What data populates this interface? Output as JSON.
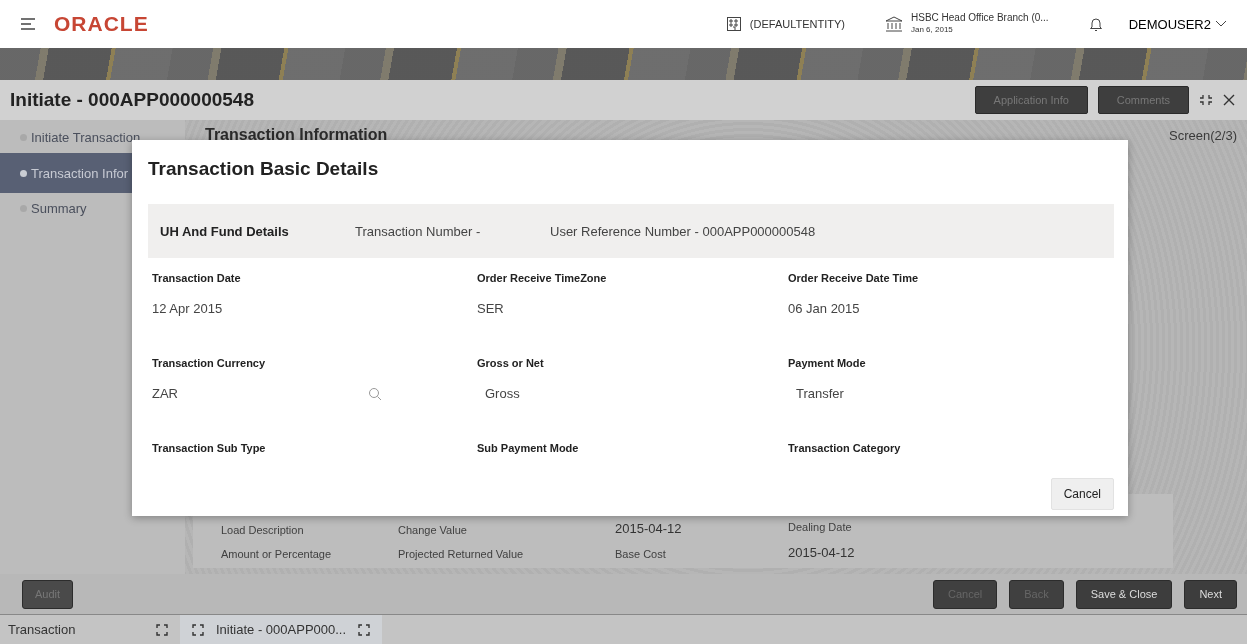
{
  "header": {
    "brand": "ORACLE",
    "entity": "(DEFAULTENTITY)",
    "branch": "HSBC Head Office Branch (0...",
    "branch_date": "Jan 6, 2015",
    "user": "DEMOUSER2"
  },
  "title_bar": {
    "title": "Initiate - 000APP000000548",
    "buttons": [
      "Application Info",
      "Comments"
    ]
  },
  "steps": [
    {
      "label": "Initiate Transaction",
      "selected": false
    },
    {
      "label": "Transaction Infor",
      "selected": true
    },
    {
      "label": "Summary",
      "selected": false
    }
  ],
  "section_title": "Transaction Information",
  "screen_indicator": "Screen(2/3)",
  "background_columns": [
    {
      "items": [
        {
          "kind": "label",
          "text": "Load Description"
        },
        {
          "kind": "label",
          "text": "Amount or Percentage"
        }
      ]
    },
    {
      "items": [
        {
          "kind": "label",
          "text": "Change Value"
        },
        {
          "kind": "label",
          "text": "Projected Returned Value"
        }
      ]
    },
    {
      "items": [
        {
          "kind": "value",
          "text": "2015-04-12"
        },
        {
          "kind": "label",
          "text": "Base Cost"
        }
      ]
    },
    {
      "items": [
        {
          "kind": "label",
          "text": "Dealing Date"
        },
        {
          "kind": "value",
          "text": "2015-04-12"
        }
      ]
    }
  ],
  "footer": {
    "left_buttons": [
      "Audit"
    ],
    "right_buttons": [
      {
        "label": "Cancel",
        "kind": "muted"
      },
      {
        "label": "Back",
        "kind": "muted"
      },
      {
        "label": "Save & Close",
        "kind": "primary"
      },
      {
        "label": "Next",
        "kind": "primary"
      }
    ]
  },
  "taskbar": [
    {
      "label": "Transaction",
      "selected": false
    },
    {
      "label": "Initiate - 000APP000...",
      "selected": true
    }
  ],
  "dialog": {
    "title": "Transaction Basic Details",
    "band": {
      "heading": "UH And Fund Details",
      "transaction_number": "Transaction Number -",
      "user_reference": "User Reference Number - 000APP000000548"
    },
    "fields": [
      {
        "label": "Transaction Date",
        "value": "12 Apr 2015",
        "kind": "text"
      },
      {
        "label": "Order Receive TimeZone",
        "value": "SER",
        "kind": "text"
      },
      {
        "label": "Order Receive Date Time",
        "value": "06 Jan 2015",
        "kind": "text"
      },
      {
        "label": "Transaction Currency",
        "value": "ZAR",
        "kind": "lookup"
      },
      {
        "label": "Gross or Net",
        "value": "Gross",
        "kind": "select"
      },
      {
        "label": "Payment Mode",
        "value": "Transfer",
        "kind": "select"
      },
      {
        "label": "Transaction Sub Type"
      },
      {
        "label": "Sub Payment Mode"
      },
      {
        "label": "Transaction Category"
      }
    ],
    "buttons": [
      "Cancel"
    ]
  }
}
